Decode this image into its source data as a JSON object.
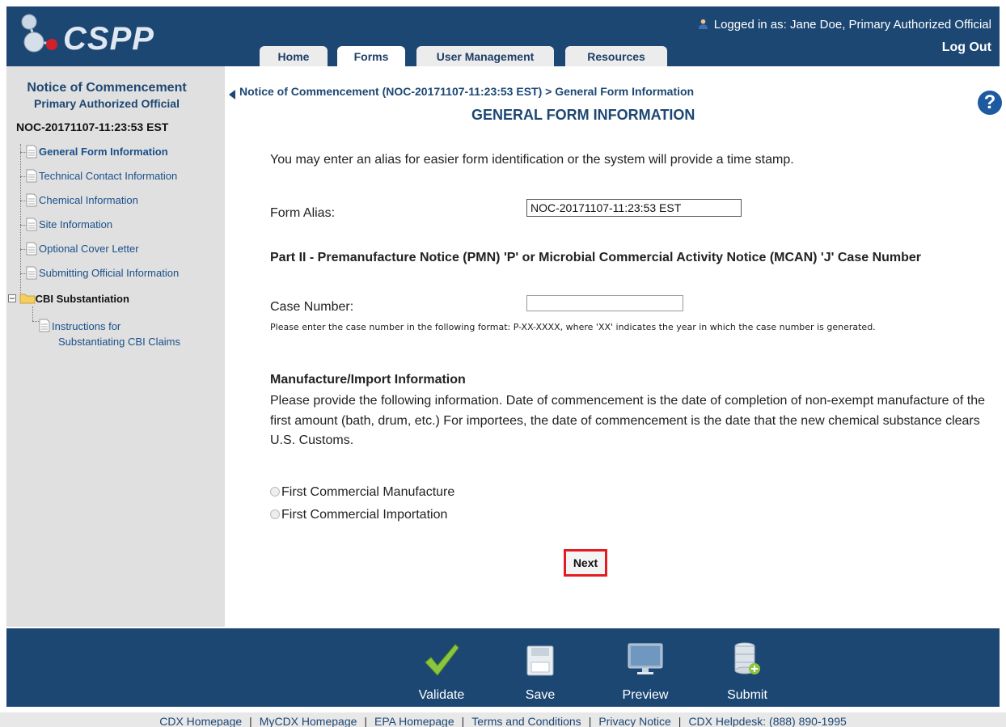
{
  "header": {
    "logo_text": "CSPP",
    "logged_in_prefix": "Logged in as:",
    "logged_in_user": "Jane Doe, Primary Authorized Official",
    "logout": "Log Out",
    "tabs": [
      "Home",
      "Forms",
      "User Management",
      "Resources"
    ],
    "active_tab": "Forms"
  },
  "sidebar": {
    "title": "Notice of Commencement",
    "subtitle": "Primary Authorized Official",
    "form_id": "NOC-20171107-11:23:53 EST",
    "items": [
      {
        "label": "General Form Information",
        "active": true
      },
      {
        "label": "Technical Contact Information",
        "active": false
      },
      {
        "label": "Chemical Information",
        "active": false
      },
      {
        "label": "Site Information",
        "active": false
      },
      {
        "label": "Optional Cover Letter",
        "active": false
      },
      {
        "label": "Submitting Official Information",
        "active": false
      }
    ],
    "cbi_folder": "CBI Substantiation",
    "cbi_item_line1": "Instructions for",
    "cbi_item_line2": "Substantiating CBI Claims"
  },
  "main": {
    "breadcrumb": "Notice of Commencement (NOC-20171107-11:23:53 EST) > General Form Information",
    "title": "GENERAL FORM INFORMATION",
    "help": "?",
    "intro": "You may enter an alias for easier form identification or the system will provide a time stamp.",
    "alias_label": "Form Alias:",
    "alias_value": "NOC-20171107-11:23:53 EST",
    "part2_heading": "Part II - Premanufacture Notice (PMN) 'P' or Microbial Commercial Activity Notice (MCAN) 'J' Case Number",
    "case_label": "Case Number:",
    "case_value": "",
    "case_hint": "Please enter the case number in the following format: P-XX-XXXX, where 'XX' indicates the year in which the case number is generated.",
    "mfg_heading": "Manufacture/Import Information",
    "mfg_text": "Please provide the following information. Date of commencement is the date of completion of non-exempt manufacture of the first amount (bath, drum, etc.) For importees, the date of commencement is the date that the new chemical substance clears U.S. Customs.",
    "radio_manufacture": "First Commercial Manufacture",
    "radio_import": "First Commercial Importation",
    "next": "Next"
  },
  "actions": {
    "validate": "Validate",
    "save": "Save",
    "preview": "Preview",
    "submit": "Submit"
  },
  "footer_links": {
    "cdx_home": "CDX Homepage",
    "mycdx_home": "MyCDX Homepage",
    "epa_home": "EPA Homepage",
    "terms": "Terms and Conditions",
    "privacy": "Privacy Notice",
    "helpdesk": "CDX Helpdesk: (888) 890-1995"
  },
  "colors": {
    "brand": "#1d4773",
    "highlight": "#e31b23"
  }
}
